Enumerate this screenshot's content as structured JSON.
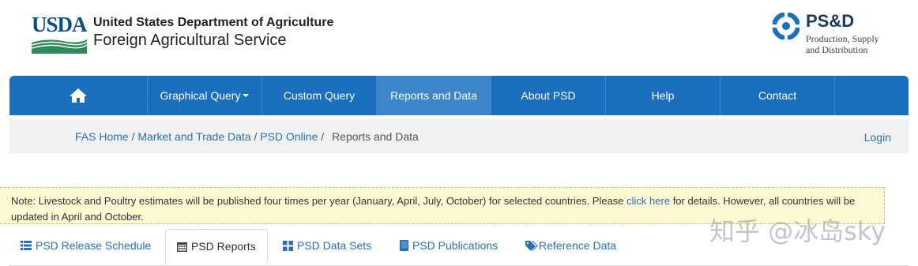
{
  "header": {
    "usda_wordmark": "USDA",
    "agency_line1": "United States Department of Agriculture",
    "agency_line2": "Foreign Agricultural Service",
    "psd_title": "PS&D",
    "psd_sub1": "Production, Supply",
    "psd_sub2": "and Distribution"
  },
  "nav": {
    "home_icon": "home-icon",
    "items": [
      {
        "label": "Graphical Query",
        "dropdown": true
      },
      {
        "label": "Custom Query"
      },
      {
        "label": "Reports and Data",
        "active": true
      },
      {
        "label": "About PSD"
      },
      {
        "label": "Help"
      },
      {
        "label": "Contact"
      }
    ],
    "color": "#1b6fbf"
  },
  "breadcrumb": {
    "items": [
      "FAS Home",
      "Market and Trade Data",
      "PSD Online"
    ],
    "current": "Reports and Data",
    "login": "Login"
  },
  "note": {
    "text_before": "Note: Livestock and Poultry estimates will be published four times per year (January, April, July, October) for selected countries. Please ",
    "link": "click here",
    "text_after": " for details. However, all countries will be updated in April and October."
  },
  "tabs": [
    {
      "label": "PSD Release Schedule",
      "icon": "list-icon"
    },
    {
      "label": "PSD Reports",
      "icon": "calendar-icon",
      "active": true
    },
    {
      "label": "PSD Data Sets",
      "icon": "grid-icon"
    },
    {
      "label": "PSD Publications",
      "icon": "book-icon"
    },
    {
      "label": "Reference Data",
      "icon": "tags-icon"
    }
  ],
  "watermark": "知乎 @冰岛sky"
}
